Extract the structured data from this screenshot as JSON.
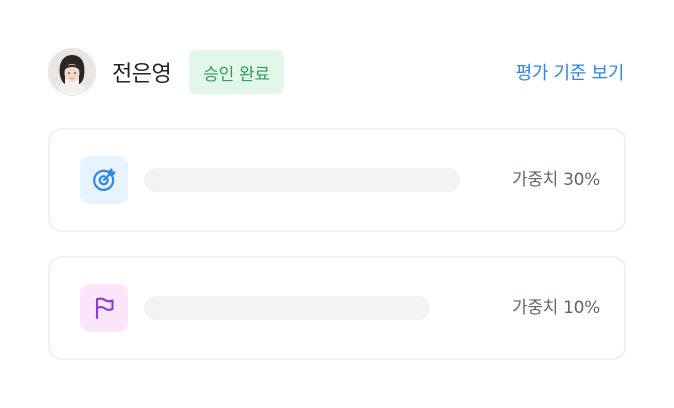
{
  "user": {
    "name": "전은영",
    "status_badge": "승인 완료",
    "status_color": "#2f9e5e",
    "status_bg": "#e3f6ea"
  },
  "header": {
    "criteria_link": "평가 기준 보기",
    "link_color": "#2f86e8"
  },
  "goals": [
    {
      "icon": "target-icon",
      "icon_color": "#2f86e8",
      "weight_label": "가중치 30%"
    },
    {
      "icon": "flag-icon",
      "icon_color": "#8a3fc7",
      "weight_label": "가중치 10%"
    }
  ]
}
